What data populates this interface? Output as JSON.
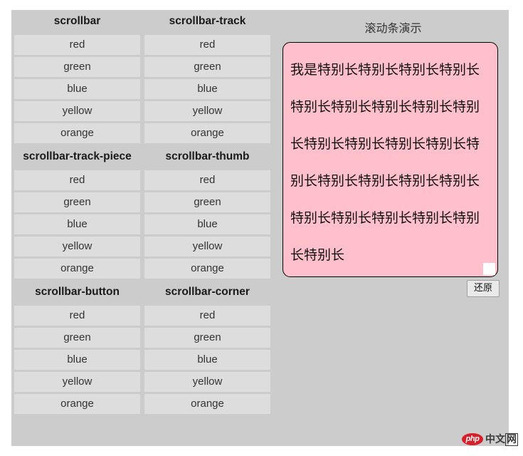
{
  "left_panel": {
    "sections": [
      {
        "headers": [
          "scrollbar",
          "scrollbar-track"
        ],
        "rows": [
          [
            "red",
            "red"
          ],
          [
            "green",
            "green"
          ],
          [
            "blue",
            "blue"
          ],
          [
            "yellow",
            "yellow"
          ],
          [
            "orange",
            "orange"
          ]
        ]
      },
      {
        "headers": [
          "scrollbar-track-piece",
          "scrollbar-thumb"
        ],
        "rows": [
          [
            "red",
            "red"
          ],
          [
            "green",
            "green"
          ],
          [
            "blue",
            "blue"
          ],
          [
            "yellow",
            "yellow"
          ],
          [
            "orange",
            "orange"
          ]
        ]
      },
      {
        "headers": [
          "scrollbar-button",
          "scrollbar-corner"
        ],
        "rows": [
          [
            "red",
            "red"
          ],
          [
            "green",
            "green"
          ],
          [
            "blue",
            "blue"
          ],
          [
            "yellow",
            "yellow"
          ],
          [
            "orange",
            "orange"
          ]
        ]
      }
    ]
  },
  "right_panel": {
    "title": "滚动条演示",
    "scroll_content": "我是特别长特别长特别长特别长特别长特别长特别长特别长特别长特别长特别长特别长特别长特别长特别长特别长特别长特别长特别长特别长特别长特别长特别长特别长",
    "restore_button_label": "还原"
  },
  "watermark": {
    "badge_text": "php",
    "cn_prefix": "中文",
    "cn_boxed": "网"
  },
  "colors": {
    "panel_background": "#cccccc",
    "cell_background": "#dddddd",
    "scroll_box_background": "#ffc0cb",
    "scroll_box_border": "#000000",
    "badge_red": "#d81e28",
    "page_background": "#ffffff"
  }
}
